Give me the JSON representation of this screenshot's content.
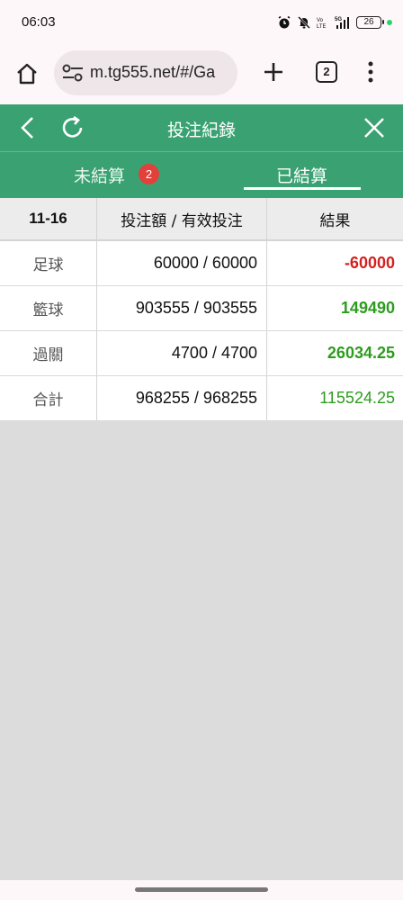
{
  "status_bar": {
    "time": "06:03",
    "battery": "26"
  },
  "browser": {
    "url": "m.tg555.net/#/Ga",
    "tab_count": "2"
  },
  "header": {
    "title": "投注紀錄"
  },
  "tabs": {
    "unsettled_label": "未結算",
    "unsettled_badge": "2",
    "settled_label": "已結算"
  },
  "table": {
    "headers": {
      "date": "11-16",
      "bet": "投注額 / 有效投注",
      "result": "結果"
    },
    "rows": [
      {
        "type": "足球",
        "bet": "60000 / 60000",
        "result": "-60000",
        "result_color": "#d42020"
      },
      {
        "type": "籃球",
        "bet": "903555 / 903555",
        "result": "149490",
        "result_color": "#2d9c1e"
      },
      {
        "type": "過關",
        "bet": "4700 / 4700",
        "result": "26034.25",
        "result_color": "#2d9c1e"
      },
      {
        "type": "合計",
        "bet": "968255 / 968255",
        "result": "115524.25",
        "result_color": "#2d9c1e"
      }
    ]
  },
  "colors": {
    "header_green": "#3aa272",
    "loss_red": "#d42020",
    "win_green": "#2d9c1e",
    "badge_red": "#e2403a"
  }
}
